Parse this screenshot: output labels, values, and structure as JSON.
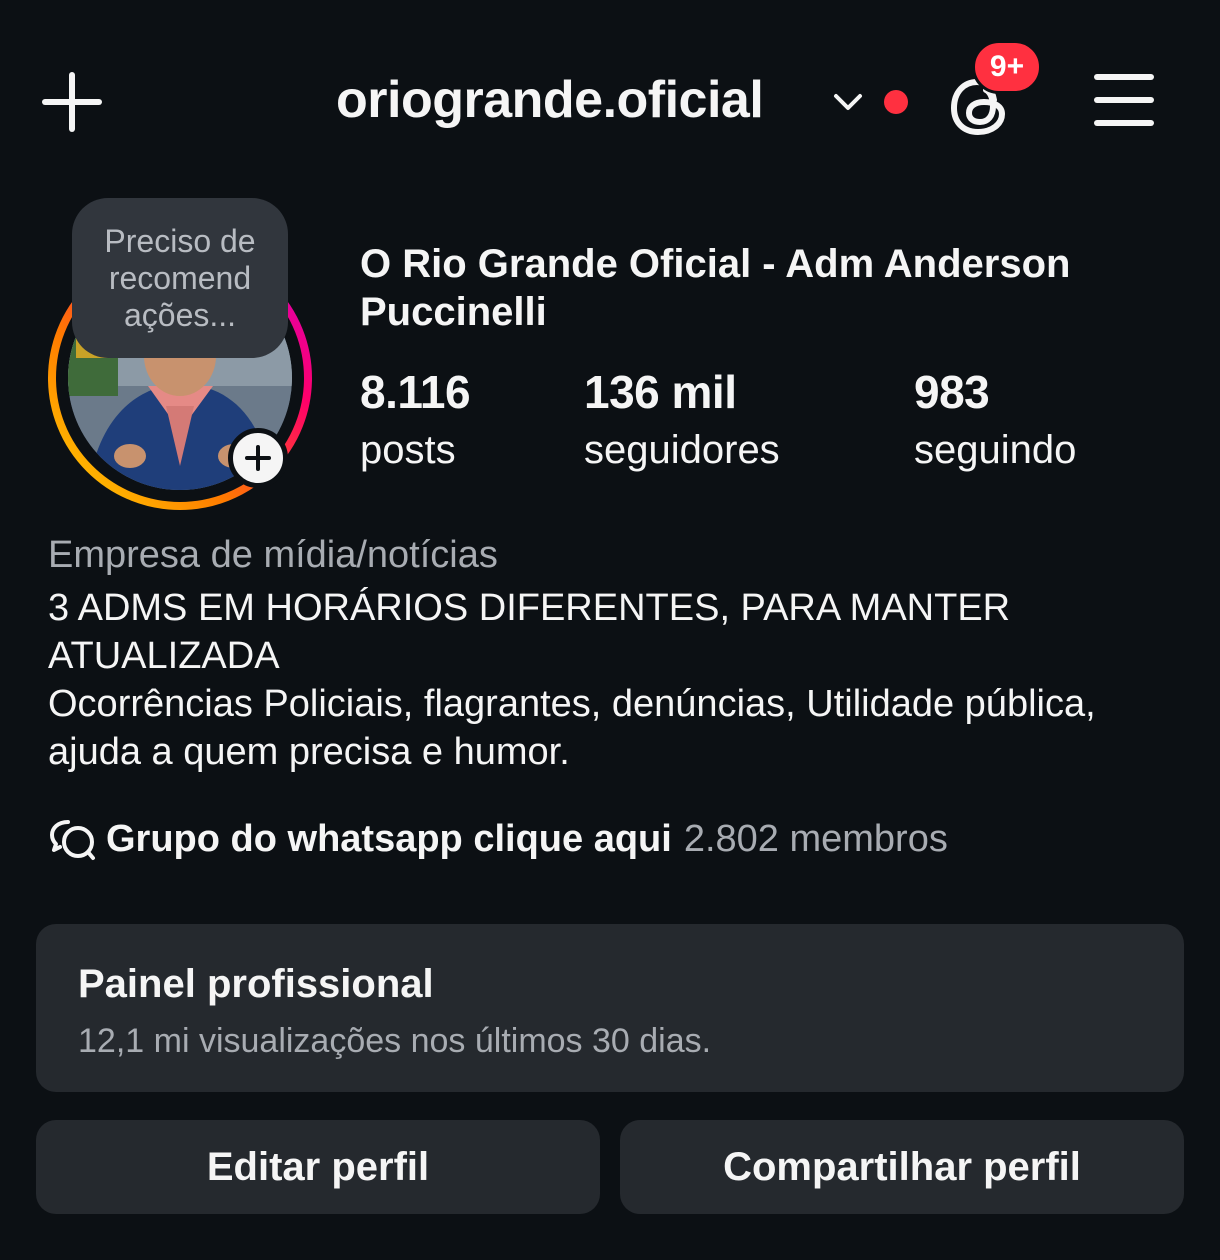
{
  "header": {
    "username": "oriogrande.oficial",
    "notification_badge": "9+",
    "icons": {
      "create": "plus-icon",
      "account_switch": "chevron-down-icon",
      "threads": "threads-icon",
      "menu": "hamburger-menu-icon"
    },
    "colors": {
      "notification_dot": "#ff3040",
      "badge_bg": "#ff3040"
    }
  },
  "avatar": {
    "note_text": "Preciso de recomend ações...",
    "add_icon": "plus-icon",
    "ring_colors": [
      "#ffd600",
      "#ff7a00",
      "#ff0069",
      "#d300c5"
    ]
  },
  "profile": {
    "full_name": "O Rio Grande Oficial - Adm Anderson Puccinelli",
    "stats": {
      "posts": {
        "value": "8.116",
        "label": "posts"
      },
      "followers": {
        "value": "136 mil",
        "label": "seguidores"
      },
      "following": {
        "value": "983",
        "label": "seguindo"
      }
    },
    "category": "Empresa de mídia/notícias",
    "bio_line_1": "3 ADMS EM HORÁRIOS DIFERENTES, PARA MANTER ATUALIZADA",
    "bio_line_2": "Ocorrências Policiais, flagrantes, denúncias, Utilidade pública, ajuda a quem precisa e humor.",
    "link": {
      "icon": "chat-bubbles-icon",
      "title": "Grupo do whatsapp clique aqui",
      "meta": "2.802 membros"
    }
  },
  "dashboard": {
    "title": "Painel profissional",
    "subtitle": "12,1 mi visualizações nos últimos 30 dias."
  },
  "actions": {
    "edit_label": "Editar perfil",
    "share_label": "Compartilhar perfil"
  },
  "theme": {
    "background": "#0c1014",
    "surface": "#25292e",
    "text_primary": "#f5f5f5",
    "text_secondary": "#a8acb2"
  }
}
